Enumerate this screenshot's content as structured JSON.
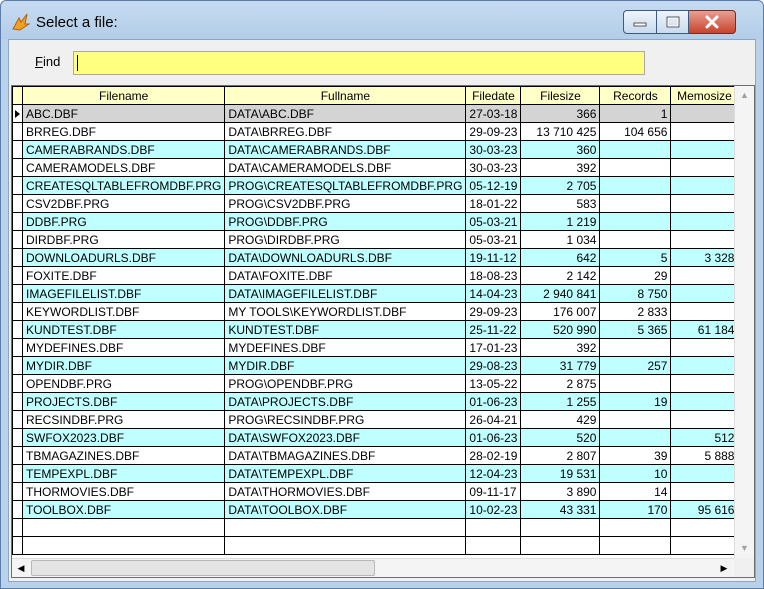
{
  "window": {
    "title": "Select a file:",
    "minimize_glyph": "–",
    "maximize_glyph": "□",
    "close_glyph": "✕"
  },
  "find": {
    "label_accel": "F",
    "label_rest": "ind",
    "value": ""
  },
  "table": {
    "columns": [
      "Filename",
      "Fullname",
      "Filedate",
      "Filesize",
      "Records",
      "Memosize"
    ],
    "rows": [
      {
        "filename": "ABC.DBF",
        "fullname": "DATA\\ABC.DBF",
        "filedate": "27-03-18",
        "filesize": "366",
        "records": "1",
        "memosize": ""
      },
      {
        "filename": "BRREG.DBF",
        "fullname": "DATA\\BRREG.DBF",
        "filedate": "29-09-23",
        "filesize": "13 710 425",
        "records": "104 656",
        "memosize": ""
      },
      {
        "filename": "CAMERABRANDS.DBF",
        "fullname": "DATA\\CAMERABRANDS.DBF",
        "filedate": "30-03-23",
        "filesize": "360",
        "records": "",
        "memosize": ""
      },
      {
        "filename": "CAMERAMODELS.DBF",
        "fullname": "DATA\\CAMERAMODELS.DBF",
        "filedate": "30-03-23",
        "filesize": "392",
        "records": "",
        "memosize": ""
      },
      {
        "filename": "CREATESQLTABLEFROMDBF.PRG",
        "fullname": "PROG\\CREATESQLTABLEFROMDBF.PRG",
        "filedate": "05-12-19",
        "filesize": "2 705",
        "records": "",
        "memosize": ""
      },
      {
        "filename": "CSV2DBF.PRG",
        "fullname": "PROG\\CSV2DBF.PRG",
        "filedate": "18-01-22",
        "filesize": "583",
        "records": "",
        "memosize": ""
      },
      {
        "filename": "DDBF.PRG",
        "fullname": "PROG\\DDBF.PRG",
        "filedate": "05-03-21",
        "filesize": "1 219",
        "records": "",
        "memosize": ""
      },
      {
        "filename": "DIRDBF.PRG",
        "fullname": "PROG\\DIRDBF.PRG",
        "filedate": "05-03-21",
        "filesize": "1 034",
        "records": "",
        "memosize": ""
      },
      {
        "filename": "DOWNLOADURLS.DBF",
        "fullname": "DATA\\DOWNLOADURLS.DBF",
        "filedate": "19-11-12",
        "filesize": "642",
        "records": "5",
        "memosize": "3 328"
      },
      {
        "filename": "FOXITE.DBF",
        "fullname": "DATA\\FOXITE.DBF",
        "filedate": "18-08-23",
        "filesize": "2 142",
        "records": "29",
        "memosize": ""
      },
      {
        "filename": "IMAGEFILELIST.DBF",
        "fullname": "DATA\\IMAGEFILELIST.DBF",
        "filedate": "14-04-23",
        "filesize": "2 940 841",
        "records": "8 750",
        "memosize": ""
      },
      {
        "filename": "KEYWORDLIST.DBF",
        "fullname": "MY TOOLS\\KEYWORDLIST.DBF",
        "filedate": "29-09-23",
        "filesize": "176 007",
        "records": "2 833",
        "memosize": ""
      },
      {
        "filename": "KUNDTEST.DBF",
        "fullname": "KUNDTEST.DBF",
        "filedate": "25-11-22",
        "filesize": "520 990",
        "records": "5 365",
        "memosize": "61 184"
      },
      {
        "filename": "MYDEFINES.DBF",
        "fullname": "MYDEFINES.DBF",
        "filedate": "17-01-23",
        "filesize": "392",
        "records": "",
        "memosize": ""
      },
      {
        "filename": "MYDIR.DBF",
        "fullname": "MYDIR.DBF",
        "filedate": "29-08-23",
        "filesize": "31 779",
        "records": "257",
        "memosize": ""
      },
      {
        "filename": "OPENDBF.PRG",
        "fullname": "PROG\\OPENDBF.PRG",
        "filedate": "13-05-22",
        "filesize": "2 875",
        "records": "",
        "memosize": ""
      },
      {
        "filename": "PROJECTS.DBF",
        "fullname": "DATA\\PROJECTS.DBF",
        "filedate": "01-06-23",
        "filesize": "1 255",
        "records": "19",
        "memosize": ""
      },
      {
        "filename": "RECSINDBF.PRG",
        "fullname": "PROG\\RECSINDBF.PRG",
        "filedate": "26-04-21",
        "filesize": "429",
        "records": "",
        "memosize": ""
      },
      {
        "filename": "SWFOX2023.DBF",
        "fullname": "DATA\\SWFOX2023.DBF",
        "filedate": "01-06-23",
        "filesize": "520",
        "records": "",
        "memosize": "512"
      },
      {
        "filename": "TBMAGAZINES.DBF",
        "fullname": "DATA\\TBMAGAZINES.DBF",
        "filedate": "28-02-19",
        "filesize": "2 807",
        "records": "39",
        "memosize": "5 888"
      },
      {
        "filename": "TEMPEXPL.DBF",
        "fullname": "DATA\\TEMPEXPL.DBF",
        "filedate": "12-04-23",
        "filesize": "19 531",
        "records": "10",
        "memosize": ""
      },
      {
        "filename": "THORMOVIES.DBF",
        "fullname": "DATA\\THORMOVIES.DBF",
        "filedate": "09-11-17",
        "filesize": "3 890",
        "records": "14",
        "memosize": ""
      },
      {
        "filename": "TOOLBOX.DBF",
        "fullname": "DATA\\TOOLBOX.DBF",
        "filedate": "10-02-23",
        "filesize": "43 331",
        "records": "170",
        "memosize": "95 616"
      }
    ]
  },
  "scrollbars": {
    "up_glyph": "▲",
    "down_glyph": "▼",
    "left_glyph": "◀",
    "right_glyph": "▶"
  },
  "colors": {
    "header_bg": "#ffffc8",
    "alt_row_bg": "#c0ffff",
    "selected_row_bg": "#d4d4d4",
    "find_bg": "#ffff80"
  },
  "selected_row": 0
}
